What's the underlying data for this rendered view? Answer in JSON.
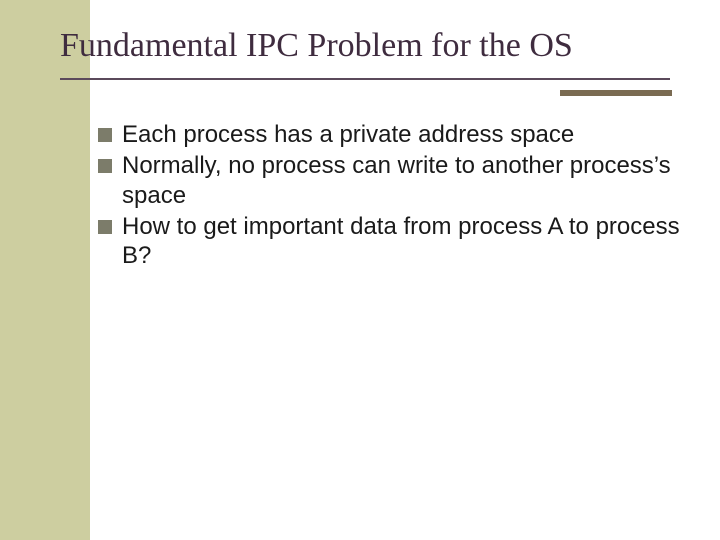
{
  "title": "Fundamental IPC Problem for the OS",
  "bullets": [
    "Each process has a private address space",
    "Normally, no process can write to another process’s space",
    "How to get important data from process A to process B?"
  ],
  "colors": {
    "sidebar": "#cdcea0",
    "title": "#3f2c3f",
    "accent": "#7a6b52",
    "bullet": "#7c7c6a"
  }
}
